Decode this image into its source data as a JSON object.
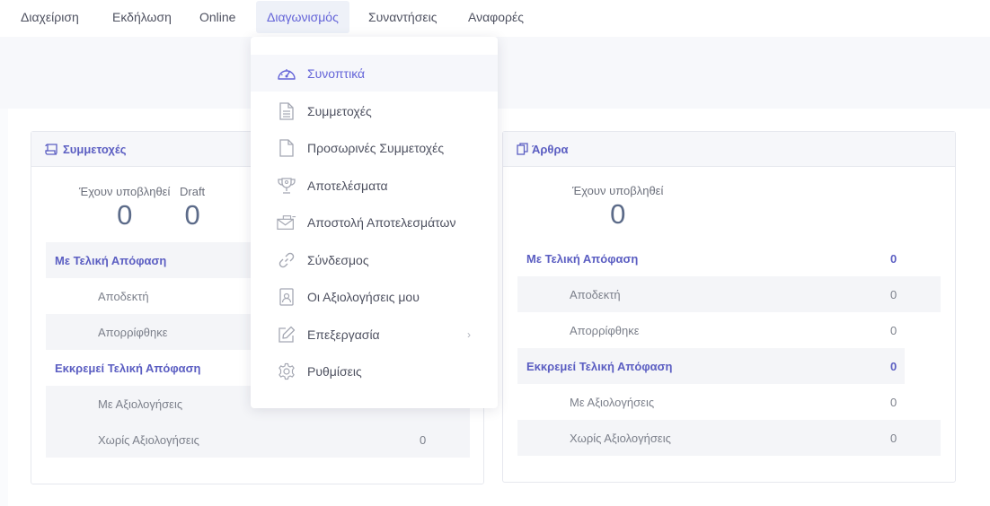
{
  "nav": {
    "items": [
      {
        "label": "Διαχείριση"
      },
      {
        "label": "Εκδήλωση"
      },
      {
        "label": "Online"
      },
      {
        "label": "Διαγωνισμός"
      },
      {
        "label": "Συναντήσεις"
      },
      {
        "label": "Αναφορές"
      }
    ]
  },
  "dropdown": {
    "items": [
      {
        "label": "Συνοπτικά",
        "icon": "gauge-icon"
      },
      {
        "label": "Συμμετοχές",
        "icon": "document-lines-icon"
      },
      {
        "label": "Προσωρινές Συμμετοχές",
        "icon": "document-icon"
      },
      {
        "label": "Αποτελέσματα",
        "icon": "trophy-icon"
      },
      {
        "label": "Αποστολή Αποτελεσμάτων",
        "icon": "mail-send-icon"
      },
      {
        "label": "Σύνδεσμος",
        "icon": "link-icon"
      },
      {
        "label": "Οι Αξιολογήσεις μου",
        "icon": "user-badge-icon"
      },
      {
        "label": "Επεξεργασία",
        "icon": "edit-icon",
        "chevron": "›"
      },
      {
        "label": "Ρυθμίσεις",
        "icon": "gear-icon"
      }
    ]
  },
  "entries_card": {
    "title": "Συμμετοχές",
    "submitted_label": "Έχουν υποβληθεί",
    "submitted_value": "0",
    "draft_label": "Draft",
    "draft_value": "0",
    "rows": [
      {
        "label": "Με Τελική Απόφαση",
        "value": ""
      },
      {
        "label": "Αποδεκτή",
        "value": ""
      },
      {
        "label": "Απορρίφθηκε",
        "value": ""
      },
      {
        "label": "Εκκρεμεί Τελική Απόφαση",
        "value": ""
      },
      {
        "label": "Με Αξιολογήσεις",
        "value": ""
      },
      {
        "label": "Χωρίς Αξιολογήσεις",
        "value": "0"
      }
    ]
  },
  "articles_card": {
    "title": "Άρθρα",
    "submitted_label": "Έχουν υποβληθεί",
    "submitted_value": "0",
    "rows": [
      {
        "label": "Με Τελική Απόφαση",
        "value": "0"
      },
      {
        "label": "Αποδεκτή",
        "value": "0"
      },
      {
        "label": "Απορρίφθηκε",
        "value": "0"
      },
      {
        "label": "Εκκρεμεί Τελική Απόφαση",
        "value": "0"
      },
      {
        "label": "Με Αξιολογήσεις",
        "value": "0"
      },
      {
        "label": "Χωρίς Αξιολογήσεις",
        "value": "0"
      }
    ]
  },
  "colors": {
    "accent": "#5b5ec2",
    "active_nav_bg": "#eef1f8",
    "row_stripe": "#f4f5f8"
  }
}
